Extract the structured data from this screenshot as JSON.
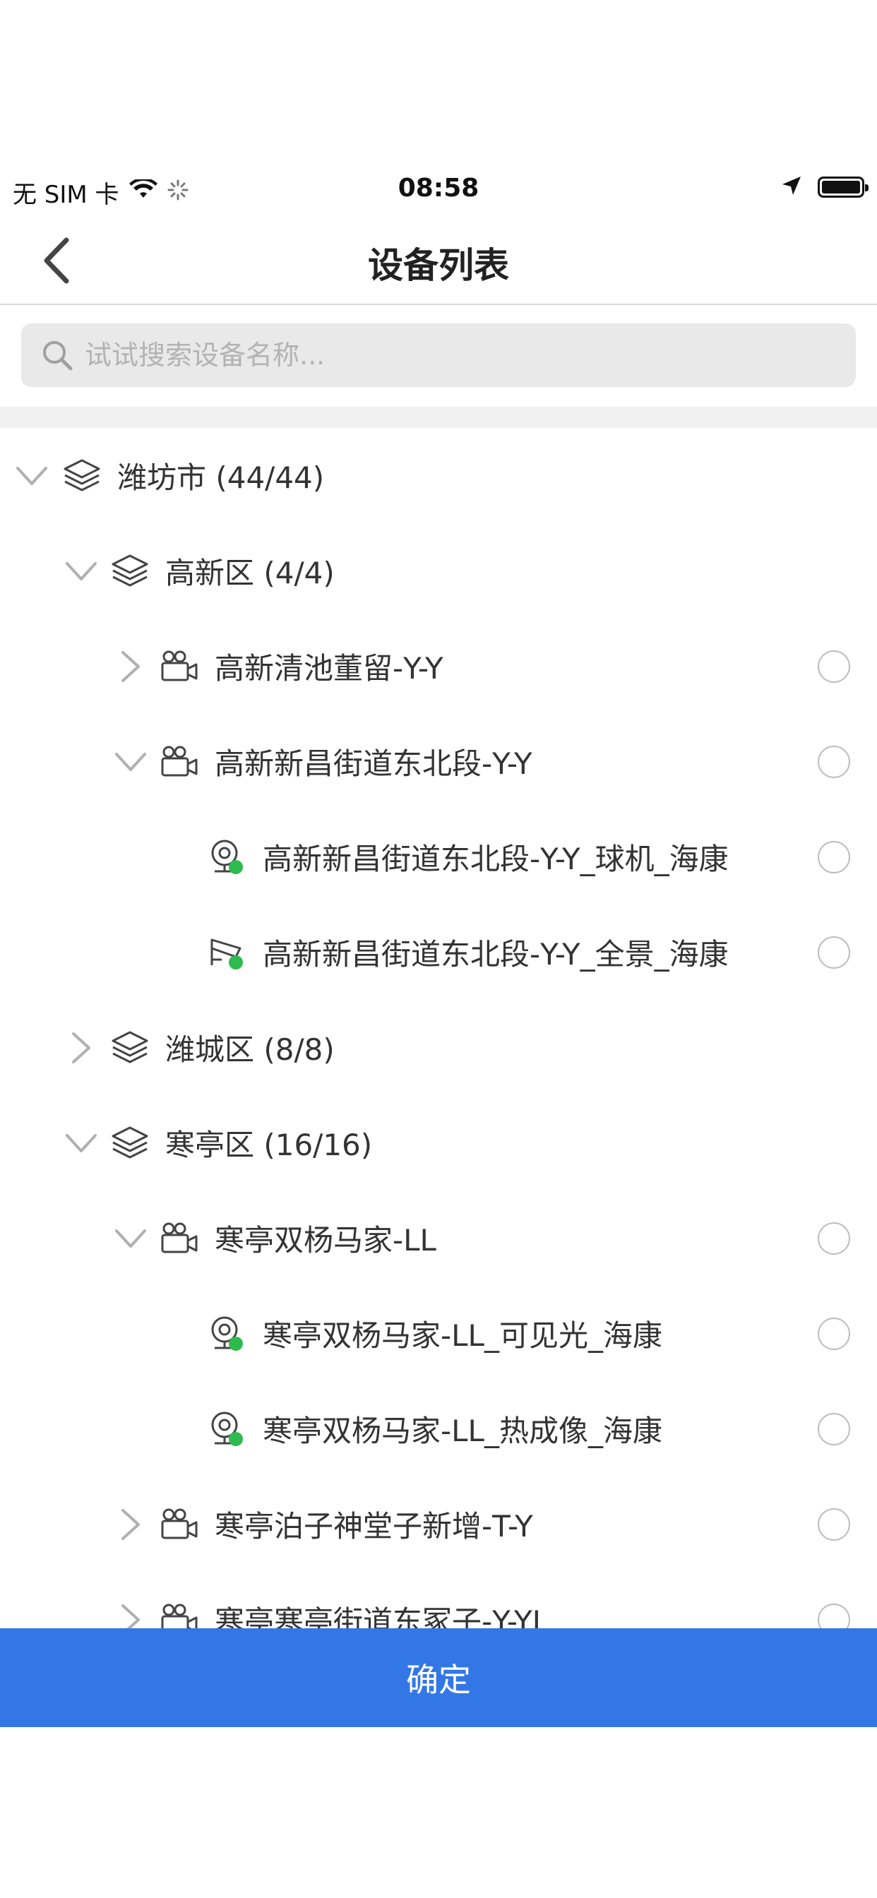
{
  "status_bar": {
    "carrier": "无 SIM 卡",
    "time": "08:58"
  },
  "nav": {
    "title": "设备列表"
  },
  "search": {
    "placeholder": "试试搜索设备名称..."
  },
  "tree": {
    "rows": [
      {
        "label": "潍坊市 (44/44)",
        "kind": "region",
        "expanded": true
      },
      {
        "label": "高新区 (4/4)",
        "kind": "region",
        "expanded": true
      },
      {
        "label": "高新清池董留-Y-Y",
        "kind": "site",
        "expanded": false
      },
      {
        "label": "高新新昌街道东北段-Y-Y",
        "kind": "site",
        "expanded": true
      },
      {
        "label": "高新新昌街道东北段-Y-Y_球机_海康",
        "kind": "dome-camera",
        "online": true
      },
      {
        "label": "高新新昌街道东北段-Y-Y_全景_海康",
        "kind": "bullet-camera",
        "online": true
      },
      {
        "label": "潍城区 (8/8)",
        "kind": "region",
        "expanded": false
      },
      {
        "label": "寒亭区 (16/16)",
        "kind": "region",
        "expanded": true
      },
      {
        "label": "寒亭双杨马家-LL",
        "kind": "site",
        "expanded": true
      },
      {
        "label": "寒亭双杨马家-LL_可见光_海康",
        "kind": "dome-camera",
        "online": true
      },
      {
        "label": "寒亭双杨马家-LL_热成像_海康",
        "kind": "dome-camera",
        "online": true
      },
      {
        "label": "寒亭泊子神堂子新增-T-Y",
        "kind": "site",
        "expanded": false
      },
      {
        "label": "寒亭寒亭街道东冢子-Y-YL",
        "kind": "site",
        "expanded": false
      }
    ]
  },
  "footer": {
    "confirm_label": "确定"
  },
  "colors": {
    "primary": "#3377e6",
    "online": "#2dbb4e",
    "text": "#333333",
    "search_bg": "#e9e9e9"
  },
  "icons": {
    "back": "chevron-left-icon",
    "search": "search-icon",
    "region": "layers-icon",
    "site": "video-camera-icon",
    "dome": "dome-camera-icon",
    "bullet": "bullet-camera-icon"
  }
}
